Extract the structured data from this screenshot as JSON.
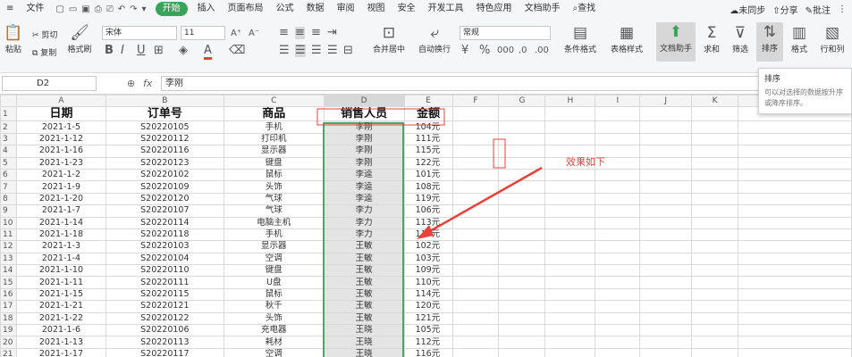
{
  "menubar": {
    "file": "文件",
    "tabs": [
      "开始",
      "插入",
      "页面布局",
      "公式",
      "数据",
      "审阅",
      "视图",
      "安全",
      "开发工具",
      "特色应用",
      "文档助手"
    ],
    "search": "查找",
    "sync": "未同步",
    "share": "分享",
    "comment": "批注"
  },
  "ribbon": {
    "paste": "粘贴",
    "cut": "剪切",
    "copy": "复制",
    "format_painter": "格式刷",
    "font_name": "宋体",
    "font_size": "11",
    "number_format": "常规",
    "merge_center": "合并居中",
    "wrap_text": "自动换行",
    "cond_format": "条件格式",
    "table_style": "表格样式",
    "doc_helper": "文档助手",
    "sum": "求和",
    "filter": "筛选",
    "sort": "排序",
    "format": "格式",
    "row_col": "行和列",
    "bold": "B",
    "italic": "I",
    "underline": "U",
    "font_color": "A"
  },
  "tooltip": {
    "title": "排序",
    "desc": "可以对选择的数据按升序或降序排序。"
  },
  "formula_bar": {
    "name_box": "D2",
    "fx": "fx",
    "value": "李刚"
  },
  "sheet": {
    "columns": [
      "A",
      "B",
      "C",
      "D",
      "E",
      "F",
      "G",
      "H",
      "I",
      "J",
      "K"
    ],
    "headers": [
      "日期",
      "订单号",
      "商品",
      "销售人员",
      "金额"
    ],
    "rows": [
      [
        "2021-1-5",
        "S20220105",
        "手机",
        "李刚",
        "104元"
      ],
      [
        "2021-1-12",
        "S20220112",
        "打印机",
        "李刚",
        "111元"
      ],
      [
        "2021-1-16",
        "S20220116",
        "显示器",
        "李刚",
        "115元"
      ],
      [
        "2021-1-23",
        "S20220123",
        "键盘",
        "李刚",
        "122元"
      ],
      [
        "2021-1-2",
        "S20220102",
        "鼠标",
        "李逵",
        "101元"
      ],
      [
        "2021-1-9",
        "S20220109",
        "头饰",
        "李逵",
        "108元"
      ],
      [
        "2021-1-20",
        "S20220120",
        "气球",
        "李逵",
        "119元"
      ],
      [
        "2021-1-7",
        "S20220107",
        "气球",
        "李力",
        "106元"
      ],
      [
        "2021-1-14",
        "S20220114",
        "电脑主机",
        "李力",
        "113元"
      ],
      [
        "2021-1-18",
        "S20220118",
        "手机",
        "李力",
        "117元"
      ],
      [
        "2021-1-3",
        "S20220103",
        "显示器",
        "王敏",
        "102元"
      ],
      [
        "2021-1-4",
        "S20220104",
        "空调",
        "王敏",
        "103元"
      ],
      [
        "2021-1-10",
        "S20220110",
        "键盘",
        "王敏",
        "109元"
      ],
      [
        "2021-1-11",
        "S20220111",
        "U盘",
        "王敏",
        "110元"
      ],
      [
        "2021-1-15",
        "S20220115",
        "鼠标",
        "王敏",
        "114元"
      ],
      [
        "2021-1-21",
        "S20220121",
        "秋千",
        "王敏",
        "120元"
      ],
      [
        "2021-1-22",
        "S20220122",
        "头饰",
        "王敏",
        "121元"
      ],
      [
        "2021-1-6",
        "S20220106",
        "充电器",
        "王晓",
        "105元"
      ],
      [
        "2021-1-13",
        "S20220113",
        "耗材",
        "王晓",
        "112元"
      ],
      [
        "2021-1-17",
        "S20220117",
        "空调",
        "王晓",
        "116元"
      ]
    ],
    "annotation": "效果如下"
  },
  "colors": {
    "accent": "#3aa35a",
    "arrow": "#e8413a",
    "selection": "#1e8e3e"
  }
}
